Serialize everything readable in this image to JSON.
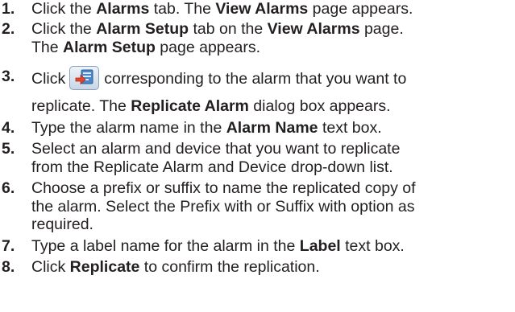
{
  "steps": [
    {
      "num": "1.",
      "parts": [
        "Click the ",
        "Alarms",
        " tab. The ",
        "View Alarms",
        " page appears."
      ]
    },
    {
      "num": "2.",
      "line1": [
        "Click the ",
        "Alarm Setup",
        " tab on the ",
        "View Alarms",
        " page."
      ],
      "line2": [
        "The ",
        "Alarm Setup",
        " page appears."
      ]
    },
    {
      "num": "3.",
      "line1_a": "Click",
      "line1_b": "corresponding to the alarm that you want to",
      "line2": [
        "replicate. The ",
        "Replicate Alarm",
        " dialog box appears."
      ],
      "icon": "replicate-icon"
    },
    {
      "num": "4.",
      "parts": [
        "Type the alarm name in the ",
        "Alarm Name",
        " text box."
      ]
    },
    {
      "num": "5.",
      "line1": "Select an alarm and device that you want to replicate",
      "line2": "from the Replicate Alarm and Device drop-down list."
    },
    {
      "num": "6.",
      "line1": "Choose a prefix or suffix to name the replicated copy of",
      "line2": "the alarm. Select the Prefix with or Suffix with option as",
      "line3": "required."
    },
    {
      "num": "7.",
      "parts": [
        "Type a label name for the alarm in the ",
        "Label",
        " text box."
      ]
    },
    {
      "num": "8.",
      "parts": [
        "Click ",
        "Replicate",
        " to confirm the replication."
      ]
    }
  ]
}
